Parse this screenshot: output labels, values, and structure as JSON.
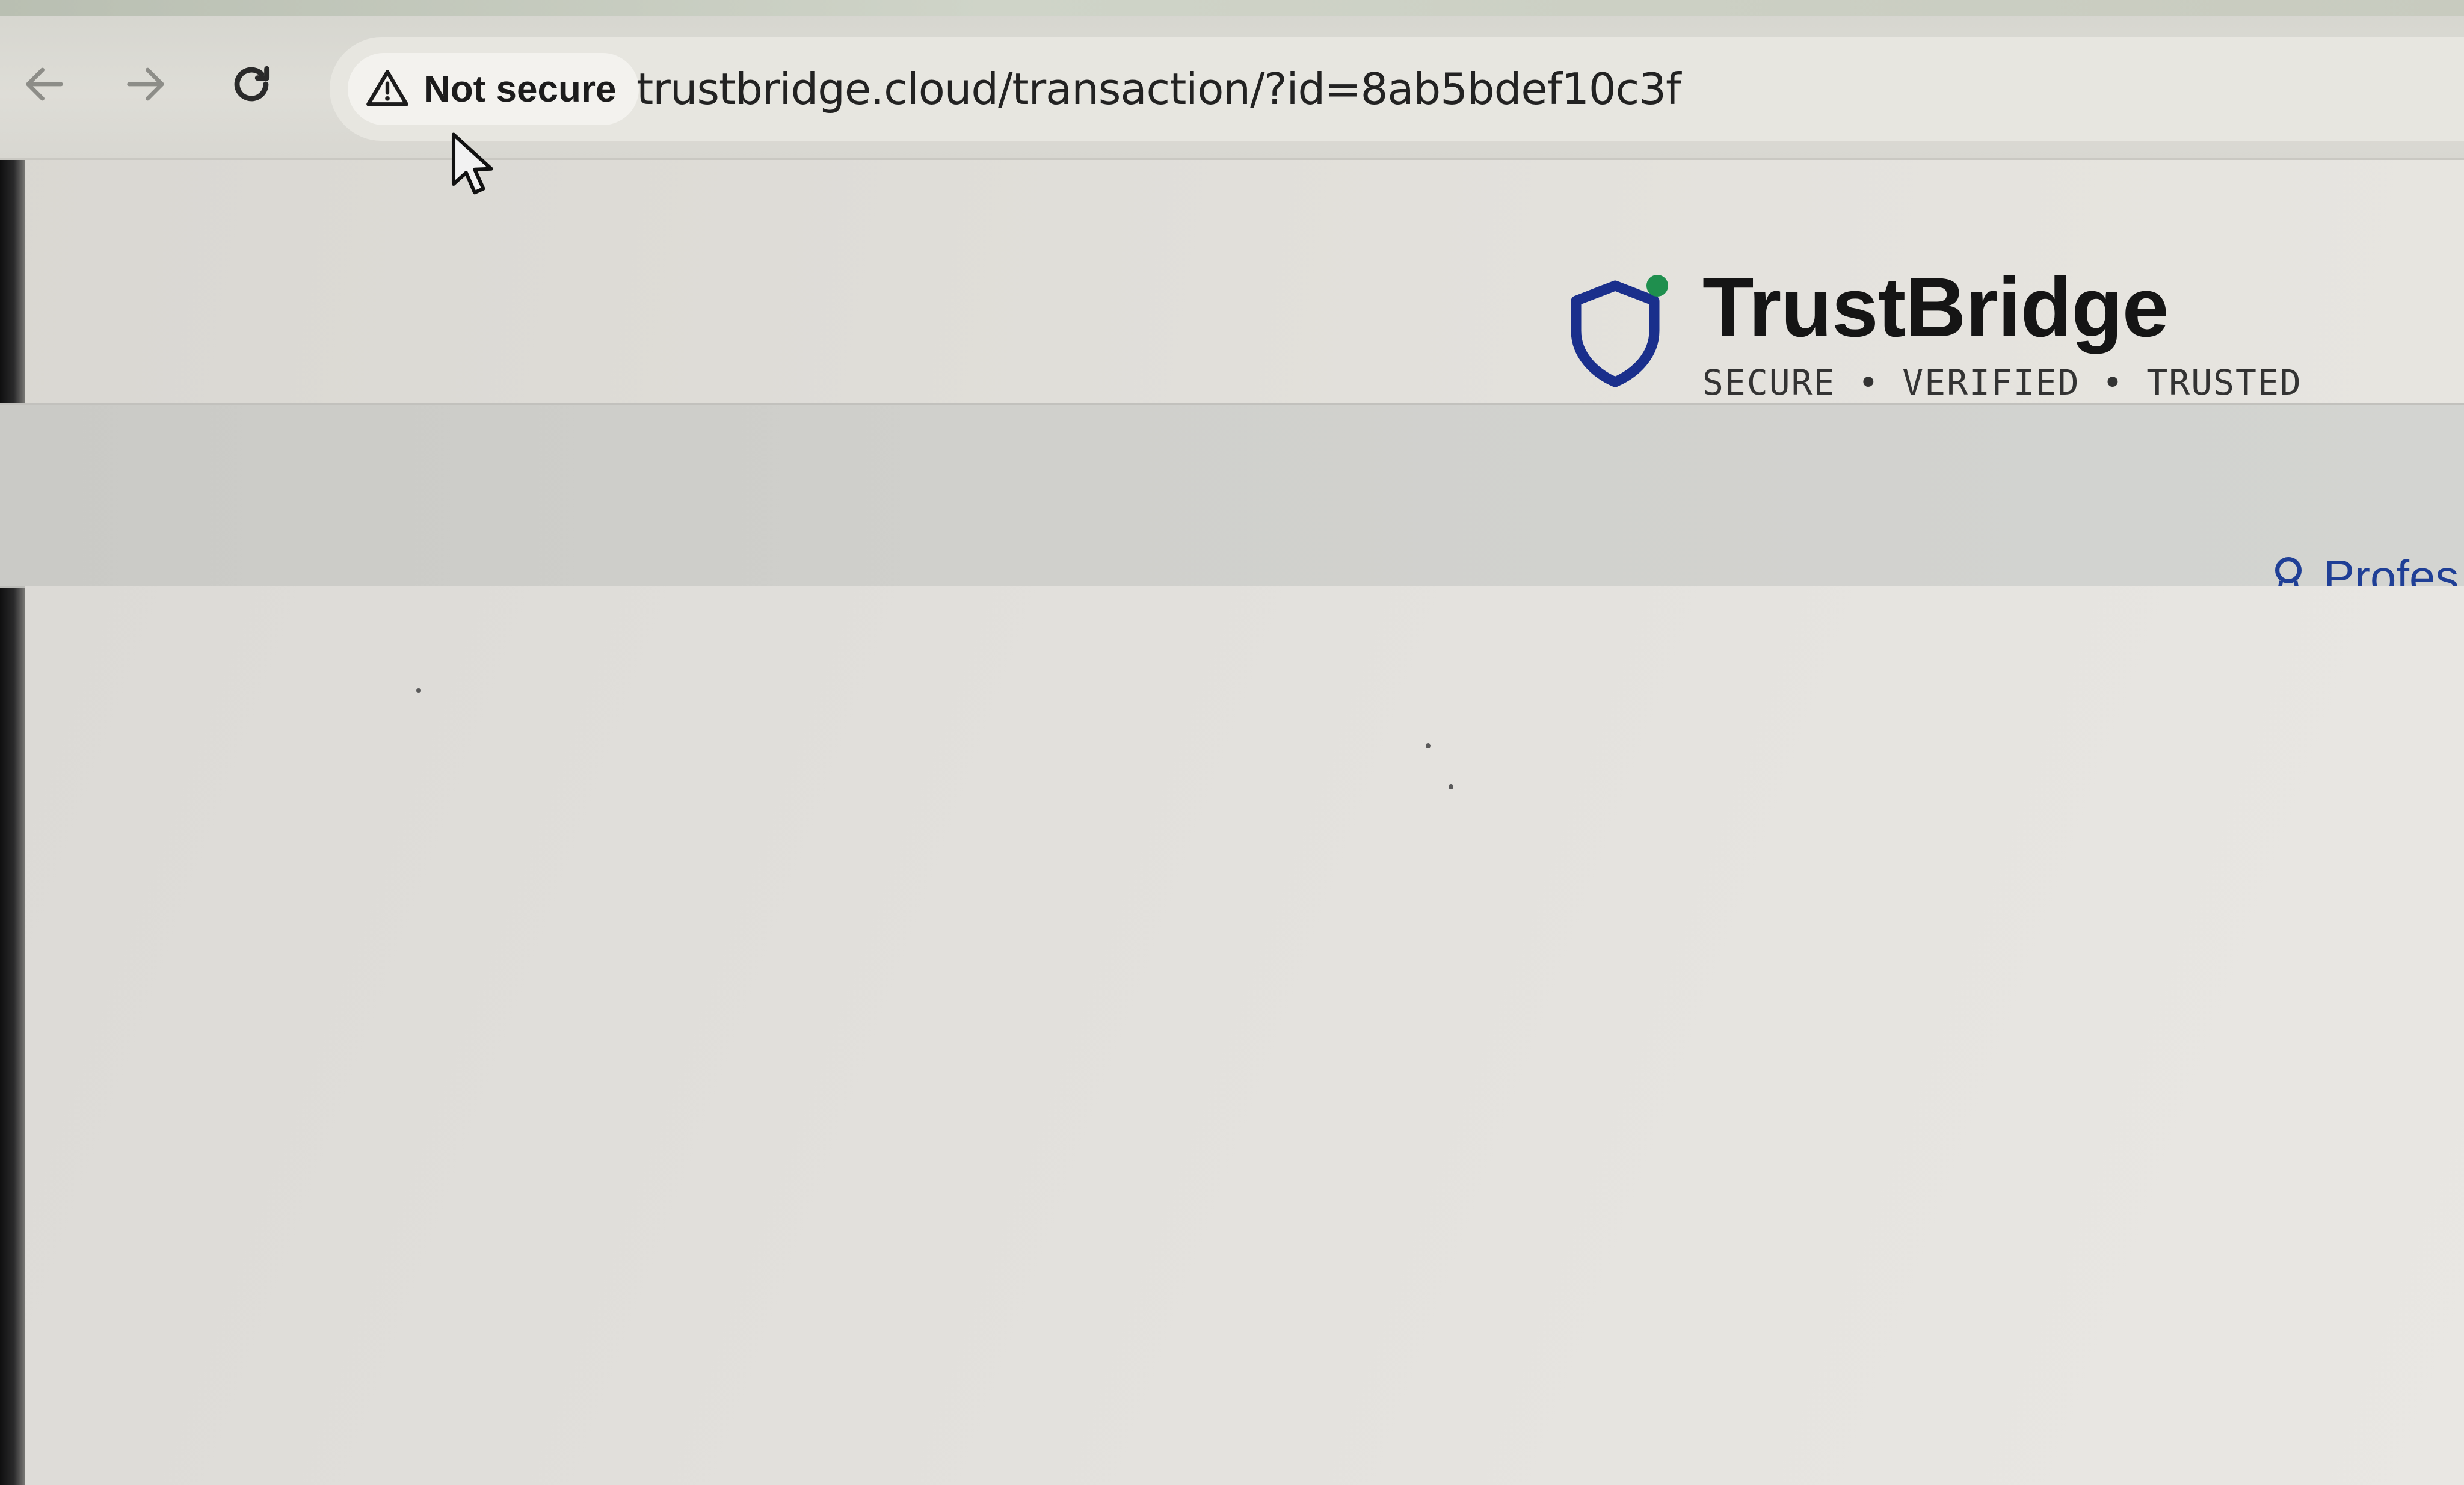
{
  "browser": {
    "security_label": "Not secure",
    "url": "trustbridge.cloud/transaction/?id=8ab5bdef10c3f",
    "icons": {
      "back": "arrow-left-icon",
      "forward": "arrow-right-icon",
      "reload": "reload-icon",
      "security": "warning-triangle-icon"
    }
  },
  "brand": {
    "name": "TrustBridge",
    "tagline": "SECURE • VERIFIED • TRUSTED",
    "logo_icon": "shield-icon",
    "logo_color": "#1a2f8c",
    "status_dot_color": "#1f8f4e"
  },
  "nav": {
    "partial_link": "Profes",
    "link_icon": "badge-icon",
    "link_color": "#1f3f96"
  }
}
